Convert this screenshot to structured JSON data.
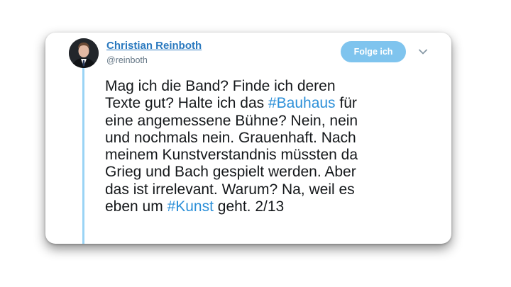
{
  "tweet": {
    "author": {
      "name": "Christian Reinboth",
      "handle": "@reinboth"
    },
    "follow_label": "Folge ich",
    "text_parts": {
      "p1": "Mag ich die Band? Finde ich deren\nTexte gut? Halte ich das ",
      "tag1": "#Bauhaus",
      "p2": " für\neine angemessene Bühne? Nein, nein\nund nochmals nein. Grauenhaft. Nach\nmeinem Kunstverstandnis müssten da\nGrieg und Bach gespielt werden. Aber\ndas ist irrelevant. Warum? Na, weil es\neben um ",
      "tag2": "#Kunst",
      "p3": " geht. 2/13"
    }
  },
  "icons": {
    "avatar": "user-photo",
    "menu": "chevron-down-icon"
  },
  "colors": {
    "link": "#2a79bf",
    "hashtag": "#2b8fd8",
    "follow_button": "#7fc4ee",
    "thread_line": "#9ad4f5",
    "text": "#14171a",
    "muted": "#657786"
  }
}
